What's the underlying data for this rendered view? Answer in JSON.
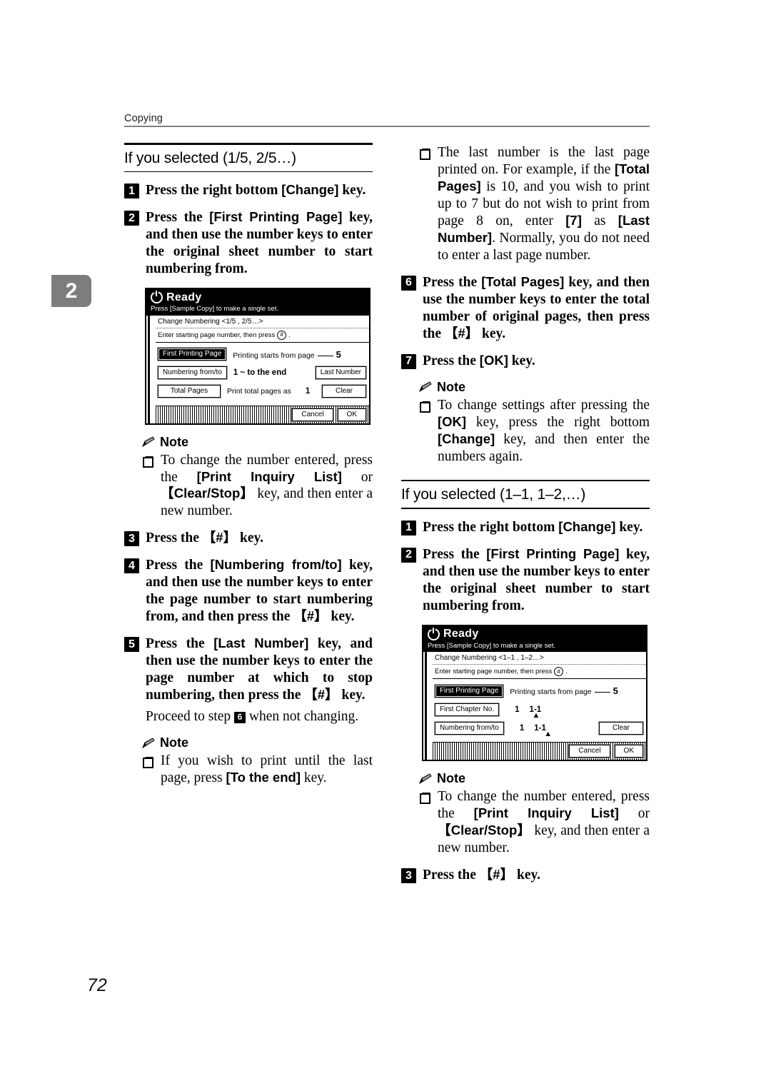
{
  "header": {
    "label": "Copying"
  },
  "chapter_tab": {
    "number": "2"
  },
  "folio": {
    "page_number": "72"
  },
  "left_column": {
    "section": {
      "title": "If you selected (1/5, 2/5…)"
    },
    "step1": {
      "num": "1",
      "text_a": "Press the right bottom ",
      "key": "[Change]",
      "text_b": " key."
    },
    "step2": {
      "num": "2",
      "text_a": "Press the ",
      "key": "[First Printing Page]",
      "text_b": " key, and then use the number keys to enter the original sheet number to start numbering from."
    },
    "note1": {
      "heading": "Note",
      "text_a": "To change the number entered, press the ",
      "key1": "[Print Inquiry List]",
      "text_b": " or ",
      "key2": "【Clear/Stop】",
      "text_c": " key, and then enter a new number."
    },
    "step3": {
      "num": "3",
      "text_a": "Press the ",
      "key": "【#】",
      "text_b": " key."
    },
    "step4": {
      "num": "4",
      "text_a": "Press the ",
      "key": "[Numbering from/to]",
      "text_b": " key, and then use the number keys to enter the page number to start numbering from, and then press the ",
      "key2": "【#】",
      "text_c": " key."
    },
    "step5": {
      "num": "5",
      "text_a": "Press the ",
      "key": "[Last Number]",
      "text_b": " key, and then use the number keys to enter the page number at which to stop numbering, then press the ",
      "key2": "【#】",
      "text_c": " key.",
      "cont_a": "Proceed to step ",
      "cont_badge": "6",
      "cont_b": " when not changing."
    },
    "note2": {
      "heading": "Note",
      "text_a": "If you wish to print until the last page, press ",
      "key1": "[To the end]",
      "text_b": " key."
    }
  },
  "right_column": {
    "note_top": {
      "text_a": "The last number is the last page printed on. For example, if the ",
      "key1": "[Total Pages]",
      "text_b": " is 10, and you wish to print up to 7 but do not wish to print from page 8 on, enter ",
      "key2": "[7]",
      "text_c": " as ",
      "key3": "[Last Number]",
      "text_d": ". Normally, you do not need to enter a last page number."
    },
    "step6": {
      "num": "6",
      "text_a": "Press the ",
      "key": "[Total Pages]",
      "text_b": " key, and then use the number keys to enter the total number of original pages, then press the ",
      "key2": "【#】",
      "text_c": " key."
    },
    "step7": {
      "num": "7",
      "text_a": "Press the ",
      "key": "[OK]",
      "text_b": " key."
    },
    "note3": {
      "heading": "Note",
      "text_a": "To change settings after pressing the ",
      "key1": "[OK]",
      "text_b": " key, press the right bottom ",
      "key2": "[Change]",
      "text_c": " key, and then enter the numbers again."
    },
    "section": {
      "title": "If you selected (1–1, 1–2,…)"
    },
    "step1": {
      "num": "1",
      "text_a": "Press the right bottom ",
      "key": "[Change]",
      "text_b": " key."
    },
    "step2": {
      "num": "2",
      "text_a": "Press the ",
      "key": "[First Printing Page]",
      "text_b": " key, and then use the number keys to enter the original sheet number to start numbering from."
    },
    "note4": {
      "heading": "Note",
      "text_a": "To change the number entered, press the ",
      "key1": "[Print Inquiry List]",
      "text_b": " or ",
      "key2": "【Clear/Stop】",
      "text_c": " key, and then enter a new number."
    },
    "step3": {
      "num": "3",
      "text_a": "Press the ",
      "key": "【#】",
      "text_b": " key."
    }
  },
  "lcd_left": {
    "status_title": "Ready",
    "status_sub": "Press [Sample Copy] to make a single set.",
    "breadcrumb": "Change Numbering   <1/5 , 2/5…>",
    "prompt": "Enter starting page number, then press",
    "prompt_symbol": "#",
    "prompt_end": ".",
    "rows": [
      {
        "button": "First Printing Page",
        "selected": true,
        "label": "Printing starts from page",
        "value": "5",
        "right_button": ""
      },
      {
        "button": "Numbering from/to",
        "selected": false,
        "label": "1  ~  to the end",
        "value": "",
        "right_button": "Last Number"
      },
      {
        "button": "Total Pages",
        "selected": false,
        "label": "Print total pages as",
        "value": "1",
        "right_button": "Clear"
      }
    ],
    "cancel": "Cancel",
    "ok": "OK"
  },
  "lcd_right": {
    "status_title": "Ready",
    "status_sub": "Press [Sample Copy] to make a single set.",
    "breadcrumb": "Change Numbering   <1–1 , 1–2…>",
    "prompt": "Enter starting page number, then press",
    "prompt_symbol": "#",
    "prompt_end": ".",
    "rows": [
      {
        "button": "First Printing Page",
        "selected": true,
        "label": "Printing starts from page",
        "value": "5",
        "right_button": ""
      },
      {
        "button": "First Chapter No.",
        "selected": false,
        "label": "1",
        "value": "1-1",
        "right_button": ""
      },
      {
        "button": "Numbering from/to",
        "selected": false,
        "label": "1",
        "value": "1-1",
        "right_button": "Clear"
      }
    ],
    "cancel": "Cancel",
    "ok": "OK"
  }
}
